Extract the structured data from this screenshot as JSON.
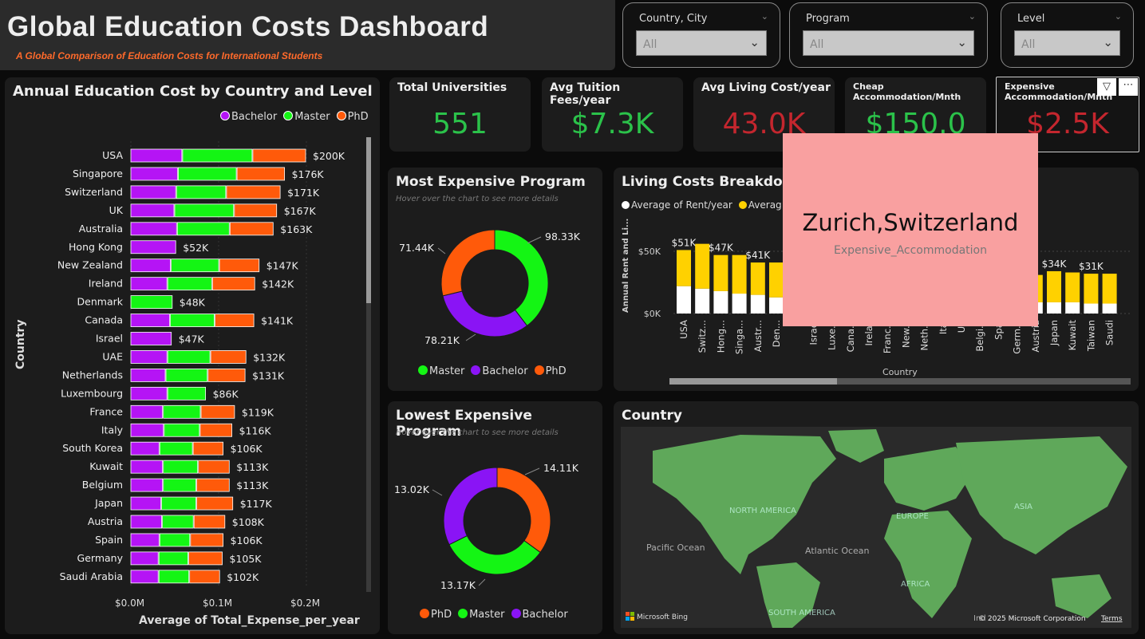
{
  "header": {
    "title": "Global Education Costs Dashboard",
    "subtitle": "A Global Comparison of Education Costs for International Students"
  },
  "filters": [
    {
      "label": "Country, City",
      "value": "All"
    },
    {
      "label": "Program",
      "value": "All"
    },
    {
      "label": "Level",
      "value": "All"
    }
  ],
  "kpis": [
    {
      "label": "Total Universities",
      "value": "551",
      "color": "#2bc24a"
    },
    {
      "label": "Avg Tuition Fees/year",
      "value": "$7.3K",
      "color": "#2bc24a"
    },
    {
      "label": "Avg Living Cost/year",
      "value": "43.0K",
      "color": "#c4262e"
    },
    {
      "label": "Cheap Accommodation/Mnth",
      "value": "$150.0",
      "color": "#2bc24a"
    },
    {
      "label": "Expensive Accommodation/Mnth",
      "value": "$2.5K",
      "color": "#c4262e"
    }
  ],
  "colors": {
    "bachelor": "#b514f5",
    "master": "#14f514",
    "phd": "#ff5a0a",
    "rent": "#ffffff",
    "avg": "#ffd100",
    "map_land": "#5fa85a",
    "map_sea": "#2a2a2a"
  },
  "chart_data": [
    {
      "type": "bar",
      "title": "Annual Education Cost by Country and Level",
      "xlabel": "Average of Total_Expense_per_year",
      "ylabel": "Country",
      "xticks": [
        "$0.0M",
        "$0.1M",
        "$0.2M"
      ],
      "xlim": [
        0,
        0.2
      ],
      "stacked": true,
      "categories": [
        "USA",
        "Singapore",
        "Switzerland",
        "UK",
        "Australia",
        "Hong Kong",
        "New Zealand",
        "Ireland",
        "Denmark",
        "Canada",
        "Israel",
        "UAE",
        "Netherlands",
        "Luxembourg",
        "France",
        "Italy",
        "South Korea",
        "Kuwait",
        "Belgium",
        "Japan",
        "Austria",
        "Spain",
        "Germany",
        "Saudi Arabia"
      ],
      "series": [
        {
          "name": "Bachelor",
          "values": [
            59,
            54,
            52,
            50,
            53,
            52,
            46,
            42,
            0,
            45,
            47,
            42,
            40,
            42,
            37,
            38,
            33,
            37,
            37,
            35,
            36,
            33,
            32,
            32
          ]
        },
        {
          "name": "Master",
          "values": [
            80,
            67,
            57,
            68,
            60,
            0,
            55,
            51,
            48,
            51,
            0,
            49,
            48,
            44,
            43,
            41,
            38,
            40,
            38,
            40,
            36,
            35,
            34,
            35
          ]
        },
        {
          "name": "PhD",
          "values": [
            61,
            55,
            62,
            49,
            50,
            0,
            46,
            49,
            0,
            45,
            0,
            41,
            43,
            0,
            39,
            37,
            35,
            36,
            38,
            42,
            36,
            38,
            39,
            35
          ]
        }
      ],
      "totals": [
        "$200K",
        "$176K",
        "$171K",
        "$167K",
        "$163K",
        "$52K",
        "$147K",
        "$142K",
        "$48K",
        "$141K",
        "$47K",
        "$132K",
        "$131K",
        "$86K",
        "$119K",
        "$116K",
        "$106K",
        "$113K",
        "$113K",
        "$117K",
        "$108K",
        "$106K",
        "$105K",
        "$102K"
      ],
      "legend": [
        "Bachelor",
        "Master",
        "PhD"
      ]
    },
    {
      "type": "pie",
      "title": "Most Expensive Program",
      "hint": "Hover over the chart to see more details",
      "labels": [
        "Master",
        "Bachelor",
        "PhD"
      ],
      "values": [
        98.33,
        78.21,
        71.44
      ],
      "value_labels": [
        "98.33K",
        "78.21K",
        "71.44K"
      ],
      "legend": [
        "Master",
        "Bachelor",
        "PhD"
      ]
    },
    {
      "type": "pie",
      "title": "Lowest Expensive Program",
      "hint": "Hover over the chart to see more details",
      "labels": [
        "PhD",
        "Master",
        "Bachelor"
      ],
      "values": [
        14.11,
        13.17,
        13.02
      ],
      "value_labels": [
        "14.11K",
        "13.17K",
        "13.02K"
      ],
      "legend": [
        "PhD",
        "Master",
        "Bachelor"
      ]
    },
    {
      "type": "bar",
      "title": "Living Costs Breakdown",
      "xlabel": "Country",
      "ylabel": "Annual Rent and Li...",
      "yticks": [
        "$50K",
        "$0K"
      ],
      "ylim": [
        0,
        60000
      ],
      "legend": [
        "Average of Rent/year",
        "Averag"
      ],
      "categories": [
        "USA",
        "Switz...",
        "Hong...",
        "Singa...",
        "Austr...",
        "Den...",
        "U",
        "Israel",
        "Luxe...",
        "Cana...",
        "Irelan",
        "Franc...",
        "New...",
        "Neth...",
        "Ital",
        "UA",
        "Belgi...",
        "Spai",
        "Germ...",
        "Austria",
        "Japan",
        "Kuwait",
        "Taiwan",
        "Saudi"
      ],
      "series": [
        {
          "name": "Average of Rent/year",
          "values": [
            22000,
            20000,
            18000,
            16000,
            15000,
            13000,
            14000,
            13000,
            13000,
            12000,
            12000,
            11000,
            11000,
            11000,
            10000,
            11000,
            10000,
            9000,
            10000,
            9000,
            9000,
            9000,
            8000,
            8000
          ]
        },
        {
          "name": "Averag",
          "values": [
            29000,
            36000,
            29000,
            31000,
            26000,
            28000,
            25000,
            24000,
            24000,
            22000,
            21000,
            21000,
            20000,
            20000,
            20000,
            19000,
            19000,
            21000,
            19000,
            22000,
            25000,
            24000,
            24000,
            24000
          ]
        }
      ],
      "value_labels": [
        "$51K",
        "",
        "$47K",
        "",
        "$41K",
        "",
        "",
        "",
        "",
        "",
        "",
        "",
        "",
        "",
        "",
        "",
        "",
        "",
        "",
        "",
        "$34K",
        "",
        "$31K",
        ""
      ]
    }
  ],
  "living": {
    "title": "Living Costs Breakdown",
    "legend1": "Average of Rent/year",
    "legend2": "Averag",
    "xlabel": "Country",
    "ylabel": "Annual Rent and Li..."
  },
  "tooltip": {
    "title": "Zurich,Switzerland",
    "subtitle": "Expensive_Accommodation"
  },
  "map": {
    "title": "Country",
    "labels": [
      "NORTH AMERICA",
      "EUROPE",
      "ASIA",
      "Pacific Ocean",
      "Atlantic Ocean",
      "AFRICA",
      "SOUTH AMERICA",
      "Ind"
    ],
    "credit": "Microsoft Bing",
    "copyright": "© 2025 Microsoft Corporation",
    "terms": "Terms"
  }
}
